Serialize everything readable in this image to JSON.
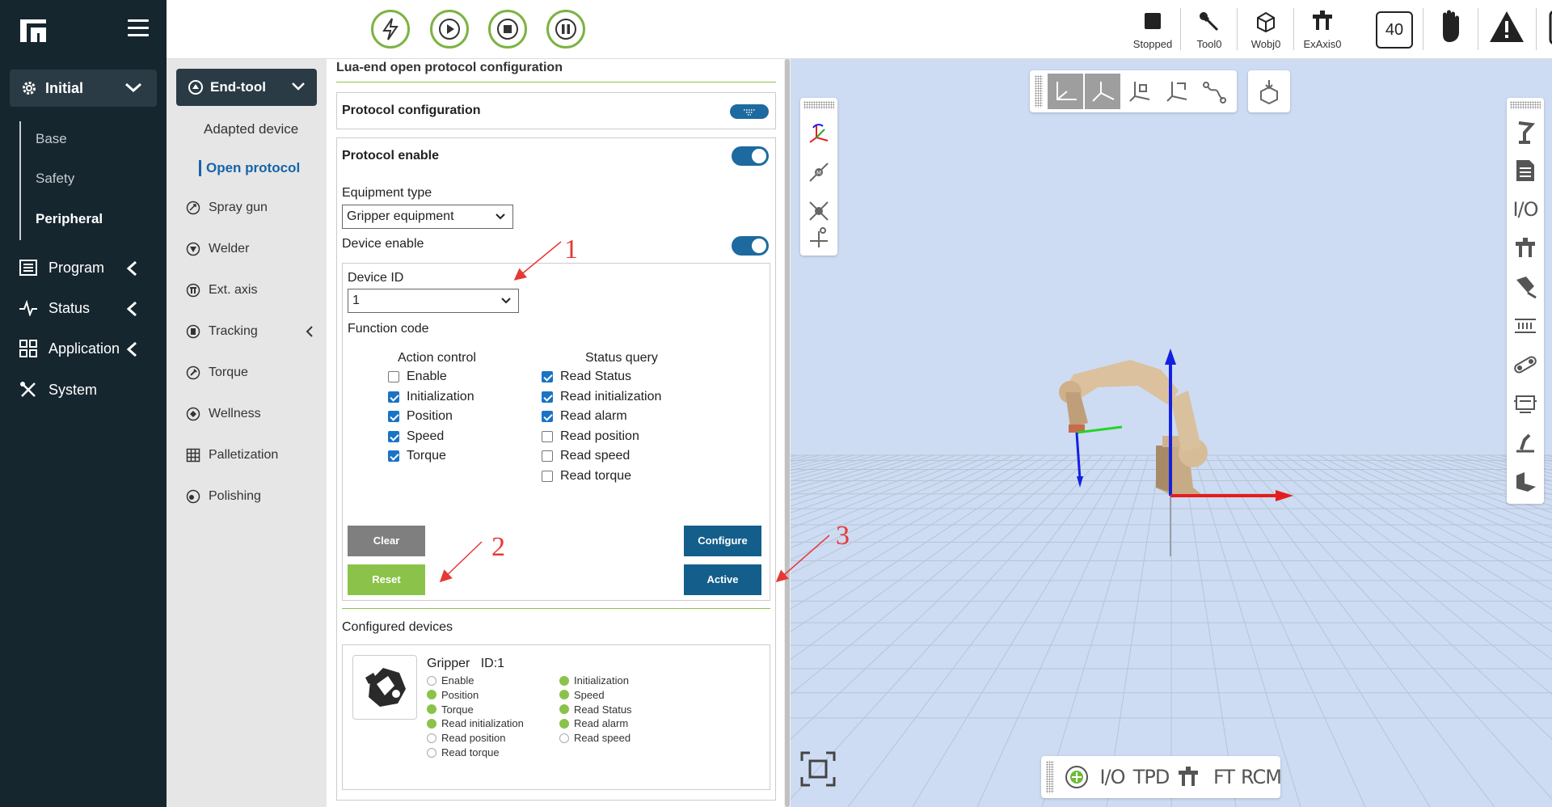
{
  "sidebar": {
    "mode_label": "Initial",
    "sub_items": [
      {
        "label": "Base",
        "active": false
      },
      {
        "label": "Safety",
        "active": false
      },
      {
        "label": "Peripheral",
        "active": true
      }
    ],
    "main_items": [
      {
        "label": "Program",
        "icon": "list-icon"
      },
      {
        "label": "Status",
        "icon": "pulse-icon"
      },
      {
        "label": "Application",
        "icon": "grid-icon"
      },
      {
        "label": "System",
        "icon": "tools-icon"
      }
    ]
  },
  "topbar": {
    "controls": [
      "enable-icon",
      "play-icon",
      "stop-icon",
      "pause-icon"
    ],
    "status_items": [
      {
        "caption": "Stopped",
        "icon": "stop-square-icon"
      },
      {
        "caption": "Tool0",
        "icon": "wrench-icon"
      },
      {
        "caption": "Wobj0",
        "icon": "cube-icon"
      },
      {
        "caption": "ExAxis0",
        "icon": "ext-axis-icon"
      }
    ],
    "speed": "40",
    "right_icons": [
      "hand-icon",
      "warning-icon",
      "no-hand-icon",
      "robot-icon",
      "user-icon"
    ]
  },
  "submenu": {
    "selected": "End-tool",
    "sub_items": [
      {
        "label": "Adapted device",
        "active": false
      },
      {
        "label": "Open protocol",
        "active": true
      }
    ],
    "items": [
      {
        "label": "Spray gun",
        "icon": "spray-icon"
      },
      {
        "label": "Welder",
        "icon": "welder-icon"
      },
      {
        "label": "Ext. axis",
        "icon": "ext-axis-icon"
      },
      {
        "label": "Tracking",
        "icon": "tracking-icon"
      },
      {
        "label": "Torque",
        "icon": "torque-icon"
      },
      {
        "label": "Wellness",
        "icon": "wellness-icon"
      },
      {
        "label": "Palletization",
        "icon": "pallet-icon"
      },
      {
        "label": "Polishing",
        "icon": "polish-icon"
      }
    ]
  },
  "panel": {
    "title": "Lua-end open protocol configuration",
    "protocol_config_label": "Protocol configuration",
    "protocol_enable_label": "Protocol enable",
    "equipment_type_label": "Equipment type",
    "equipment_type_value": "Gripper equipment",
    "device_enable_label": "Device enable",
    "device_id_label": "Device ID",
    "device_id_value": "1",
    "function_code_label": "Function code",
    "action_control_label": "Action control",
    "status_query_label": "Status query",
    "action_control": [
      {
        "label": "Enable",
        "checked": false
      },
      {
        "label": "Initialization",
        "checked": true
      },
      {
        "label": "Position",
        "checked": true
      },
      {
        "label": "Speed",
        "checked": true
      },
      {
        "label": "Torque",
        "checked": true
      }
    ],
    "status_query": [
      {
        "label": "Read Status",
        "checked": true
      },
      {
        "label": "Read initialization",
        "checked": true
      },
      {
        "label": "Read alarm",
        "checked": true
      },
      {
        "label": "Read position",
        "checked": false
      },
      {
        "label": "Read speed",
        "checked": false
      },
      {
        "label": "Read torque",
        "checked": false
      }
    ],
    "buttons": {
      "clear": "Clear",
      "reset": "Reset",
      "configure": "Configure",
      "active": "Active"
    },
    "configured_devices_label": "Configured devices",
    "device_card": {
      "name": "Gripper",
      "id": "ID:1",
      "left_col": [
        {
          "label": "Enable",
          "on": false
        },
        {
          "label": "Position",
          "on": true
        },
        {
          "label": "Torque",
          "on": true
        },
        {
          "label": "Read initialization",
          "on": true
        },
        {
          "label": "Read position",
          "on": false
        },
        {
          "label": "Read torque",
          "on": false
        }
      ],
      "right_col": [
        {
          "label": "Initialization",
          "on": true
        },
        {
          "label": "Speed",
          "on": true
        },
        {
          "label": "Read Status",
          "on": true
        },
        {
          "label": "Read alarm",
          "on": true
        },
        {
          "label": "Read speed",
          "on": false
        }
      ]
    }
  },
  "annotations": [
    "1",
    "2",
    "3"
  ],
  "view3d": {
    "bottom_tools": [
      "target-icon",
      "I/O",
      "TPD",
      "ext-axis-icon",
      "FT",
      "RCM"
    ],
    "background": "#cddcf3"
  },
  "colors": {
    "sidebar": "#16262f",
    "accent_green": "#8bc34a",
    "accent_blue": "#145e8c",
    "annotation": "#e53935"
  }
}
